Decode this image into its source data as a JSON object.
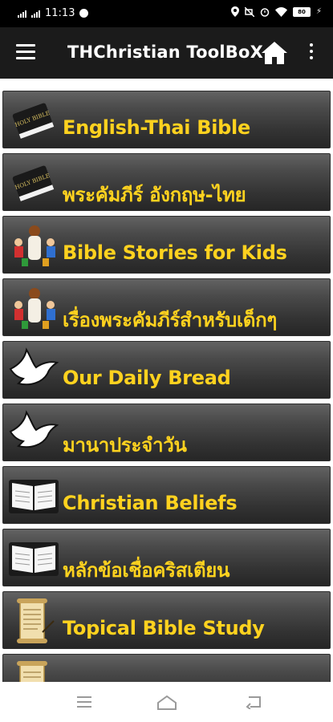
{
  "status_bar": {
    "time": "11:13",
    "battery": "80"
  },
  "app_bar": {
    "title": "THChristian ToolBoX"
  },
  "menu": {
    "items": [
      {
        "label": "English-Thai Bible",
        "icon": "bible-book-icon"
      },
      {
        "label": "พระคัมภีร์ อังกฤษ-ไทย",
        "icon": "bible-book-icon"
      },
      {
        "label": "Bible Stories for Kids",
        "icon": "jesus-children-icon"
      },
      {
        "label": "เรื่องพระคัมภีร์สำหรับเด็กๆ",
        "icon": "jesus-children-icon"
      },
      {
        "label": "Our Daily Bread",
        "icon": "dove-icon"
      },
      {
        "label": "มานาประจำวัน",
        "icon": "dove-icon"
      },
      {
        "label": "Christian Beliefs",
        "icon": "open-bible-icon"
      },
      {
        "label": "หลักข้อเชื่อคริสเตียน",
        "icon": "open-bible-icon"
      },
      {
        "label": "Topical Bible Study",
        "icon": "scroll-icon"
      },
      {
        "label": "",
        "icon": "scroll-icon"
      }
    ]
  },
  "colors": {
    "label": "#ffd21f",
    "app_bar": "#1b1b1b",
    "status_bar": "#000000"
  }
}
